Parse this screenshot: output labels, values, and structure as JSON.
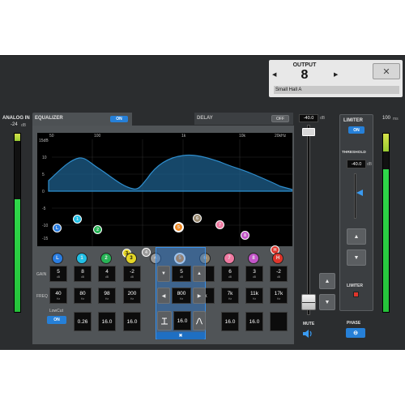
{
  "output": {
    "title": "OUTPUT",
    "number": "8",
    "prev_arrow": "◀",
    "next_arrow": "▶",
    "preset": "Small Hall A",
    "close_icon": "✕"
  },
  "input_meter": {
    "label": "ANALOG IN",
    "value": "-24",
    "unit": "dB",
    "level": 0.63
  },
  "tabs": {
    "equalizer": "EQUALIZER",
    "equalizer_state": "ON",
    "delay": "DELAY",
    "delay_state": "OFF"
  },
  "graph": {
    "freq_ticks": [
      "50",
      "100",
      "1k",
      "10k",
      "20kHz"
    ],
    "db_ticks": [
      "15dB",
      "10",
      "5",
      "0",
      "-5",
      "-10",
      "-15"
    ]
  },
  "bands": [
    {
      "label": "L",
      "color": "#2a7de1",
      "gain": "5",
      "freq": "40",
      "q": ""
    },
    {
      "label": "1",
      "color": "#22c0e6",
      "gain": "8",
      "freq": "80",
      "q": "0.26"
    },
    {
      "label": "2",
      "color": "#27b456",
      "gain": "4",
      "freq": "98",
      "q": "16.0"
    },
    {
      "label": "3",
      "color": "#e4d626",
      "gain": "-2",
      "freq": "200",
      "q": "16.0"
    },
    {
      "label": "4",
      "color": "#9a9a9a",
      "gain": "",
      "freq": "",
      "q": ""
    },
    {
      "label": "5",
      "color": "#f08a25",
      "gain": "5",
      "freq": "800",
      "q": "16.0"
    },
    {
      "label": "6",
      "color": "#9a8a70",
      "gain": "",
      "freq": "k",
      "q": ""
    },
    {
      "label": "7",
      "color": "#f07aa2",
      "gain": "6",
      "freq": "7k",
      "q": "16.0"
    },
    {
      "label": "8",
      "color": "#c255c8",
      "gain": "3",
      "freq": "11k",
      "q": "16.0"
    },
    {
      "label": "H",
      "color": "#e0352b",
      "gain": "-2",
      "freq": "17k",
      "q": ""
    }
  ],
  "row_labels": {
    "gain": "GAIN",
    "freq": "FREQ",
    "lowcut": "LowCut",
    "lowcut_state": "ON"
  },
  "units": {
    "gain": "dB",
    "freq": "Hz",
    "q": "Q"
  },
  "fader": {
    "value": "-40.0",
    "unit": "dB",
    "level": 0.03,
    "mute_label": "MUTE",
    "meter_value": "100",
    "meter_unit": "ms",
    "meter_level": 0.8
  },
  "limiter": {
    "title": "LIMITER",
    "state": "ON",
    "threshold_label": "THRESHOLD",
    "threshold_value": "-40.0",
    "threshold_unit": "dB",
    "indicator_label": "LIMITER"
  },
  "phase": {
    "label": "PHASE",
    "icon": "⊖"
  },
  "popup": {
    "up": "▲",
    "down": "▼",
    "left": "◀",
    "right": "▶",
    "close": "✖"
  }
}
